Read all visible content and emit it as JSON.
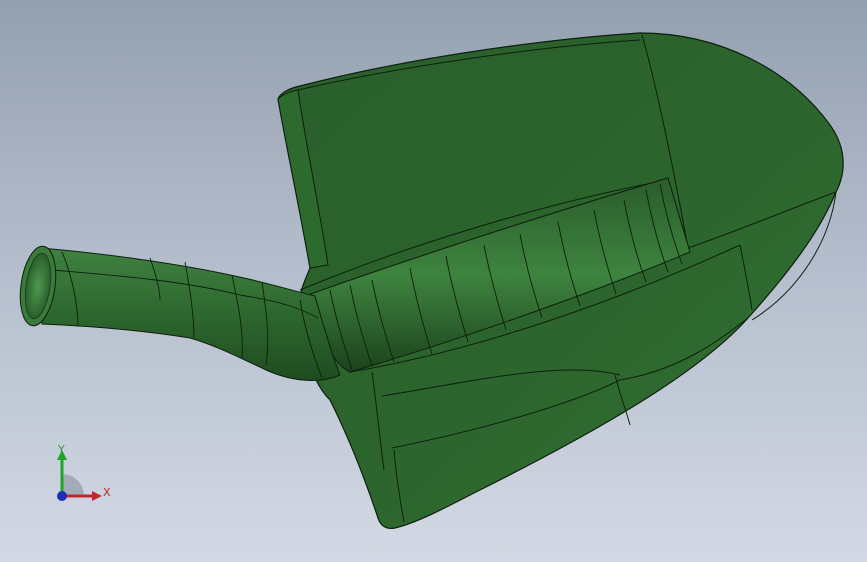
{
  "viewport": {
    "background_top": "#94a0b0",
    "background_bottom": "#d3d9e4"
  },
  "model": {
    "name_icon": "shovel-part-icon",
    "body_color": "#2f6a30",
    "edge_color": "#0d1f0d"
  },
  "triad": {
    "x_label": "X",
    "y_label": "Y",
    "x_color": "#c0272d",
    "y_color": "#1fa32a",
    "z_color": "#1c2fb5"
  }
}
